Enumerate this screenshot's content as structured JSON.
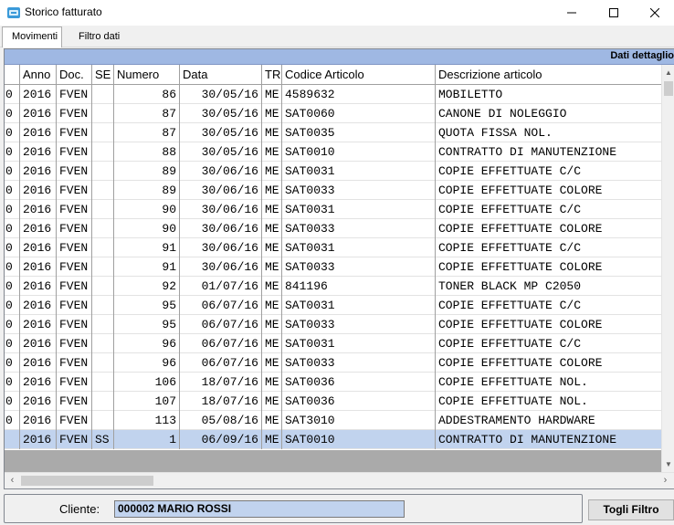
{
  "window": {
    "title": "Storico fatturato",
    "minimize_icon": "minimize-icon",
    "maximize_icon": "maximize-icon",
    "close_icon": "close-icon"
  },
  "tabs": [
    {
      "label": "Movimenti",
      "active": true
    },
    {
      "label": "Filtro dati",
      "active": false
    }
  ],
  "grid": {
    "group_header": "Dati dettaglio",
    "columns": [
      "",
      "Anno",
      "Doc.",
      "SE",
      "Numero",
      "Data",
      "TR",
      "Codice Articolo",
      "Descrizione articolo"
    ],
    "rows": [
      {
        "sel": "0",
        "anno": "2016",
        "doc": "FVEN",
        "se": "",
        "numero": "86",
        "data": "30/05/16",
        "tr": "ME",
        "codice": "4589632",
        "descrizione": "MOBILETTO"
      },
      {
        "sel": "0",
        "anno": "2016",
        "doc": "FVEN",
        "se": "",
        "numero": "87",
        "data": "30/05/16",
        "tr": "ME",
        "codice": "SAT0060",
        "descrizione": "CANONE DI NOLEGGIO"
      },
      {
        "sel": "0",
        "anno": "2016",
        "doc": "FVEN",
        "se": "",
        "numero": "87",
        "data": "30/05/16",
        "tr": "ME",
        "codice": "SAT0035",
        "descrizione": "QUOTA FISSA NOL."
      },
      {
        "sel": "0",
        "anno": "2016",
        "doc": "FVEN",
        "se": "",
        "numero": "88",
        "data": "30/05/16",
        "tr": "ME",
        "codice": "SAT0010",
        "descrizione": "CONTRATTO DI MANUTENZIONE"
      },
      {
        "sel": "0",
        "anno": "2016",
        "doc": "FVEN",
        "se": "",
        "numero": "89",
        "data": "30/06/16",
        "tr": "ME",
        "codice": "SAT0031",
        "descrizione": "COPIE EFFETTUATE C/C"
      },
      {
        "sel": "0",
        "anno": "2016",
        "doc": "FVEN",
        "se": "",
        "numero": "89",
        "data": "30/06/16",
        "tr": "ME",
        "codice": "SAT0033",
        "descrizione": "COPIE EFFETTUATE COLORE"
      },
      {
        "sel": "0",
        "anno": "2016",
        "doc": "FVEN",
        "se": "",
        "numero": "90",
        "data": "30/06/16",
        "tr": "ME",
        "codice": "SAT0031",
        "descrizione": "COPIE EFFETTUATE C/C"
      },
      {
        "sel": "0",
        "anno": "2016",
        "doc": "FVEN",
        "se": "",
        "numero": "90",
        "data": "30/06/16",
        "tr": "ME",
        "codice": "SAT0033",
        "descrizione": "COPIE EFFETTUATE COLORE"
      },
      {
        "sel": "0",
        "anno": "2016",
        "doc": "FVEN",
        "se": "",
        "numero": "91",
        "data": "30/06/16",
        "tr": "ME",
        "codice": "SAT0031",
        "descrizione": "COPIE EFFETTUATE C/C"
      },
      {
        "sel": "0",
        "anno": "2016",
        "doc": "FVEN",
        "se": "",
        "numero": "91",
        "data": "30/06/16",
        "tr": "ME",
        "codice": "SAT0033",
        "descrizione": "COPIE EFFETTUATE COLORE"
      },
      {
        "sel": "0",
        "anno": "2016",
        "doc": "FVEN",
        "se": "",
        "numero": "92",
        "data": "01/07/16",
        "tr": "ME",
        "codice": "841196",
        "descrizione": "TONER BLACK MP C2050"
      },
      {
        "sel": "0",
        "anno": "2016",
        "doc": "FVEN",
        "se": "",
        "numero": "95",
        "data": "06/07/16",
        "tr": "ME",
        "codice": "SAT0031",
        "descrizione": "COPIE EFFETTUATE C/C"
      },
      {
        "sel": "0",
        "anno": "2016",
        "doc": "FVEN",
        "se": "",
        "numero": "95",
        "data": "06/07/16",
        "tr": "ME",
        "codice": "SAT0033",
        "descrizione": "COPIE EFFETTUATE COLORE"
      },
      {
        "sel": "0",
        "anno": "2016",
        "doc": "FVEN",
        "se": "",
        "numero": "96",
        "data": "06/07/16",
        "tr": "ME",
        "codice": "SAT0031",
        "descrizione": "COPIE EFFETTUATE C/C"
      },
      {
        "sel": "0",
        "anno": "2016",
        "doc": "FVEN",
        "se": "",
        "numero": "96",
        "data": "06/07/16",
        "tr": "ME",
        "codice": "SAT0033",
        "descrizione": "COPIE EFFETTUATE COLORE"
      },
      {
        "sel": "0",
        "anno": "2016",
        "doc": "FVEN",
        "se": "",
        "numero": "106",
        "data": "18/07/16",
        "tr": "ME",
        "codice": "SAT0036",
        "descrizione": "COPIE EFFETTUATE NOL."
      },
      {
        "sel": "0",
        "anno": "2016",
        "doc": "FVEN",
        "se": "",
        "numero": "107",
        "data": "18/07/16",
        "tr": "ME",
        "codice": "SAT0036",
        "descrizione": "COPIE EFFETTUATE NOL."
      },
      {
        "sel": "0",
        "anno": "2016",
        "doc": "FVEN",
        "se": "",
        "numero": "113",
        "data": "05/08/16",
        "tr": "ME",
        "codice": "SAT3010",
        "descrizione": "ADDESTRAMENTO HARDWARE"
      },
      {
        "sel": "",
        "anno": "2016",
        "doc": "FVEN",
        "se": "SS",
        "numero": "1",
        "data": "06/09/16",
        "tr": "ME",
        "codice": "SAT0010",
        "descrizione": "CONTRATTO DI MANUTENZIONE",
        "selected": true
      }
    ]
  },
  "footer": {
    "cliente_label": "Cliente:",
    "cliente_value": "000002 MARIO ROSSI",
    "filter_button": "Togli Filtro"
  },
  "colors": {
    "group_header_bg": "#9fb8e3",
    "selected_row_bg": "#c1d3ee",
    "client_field_bg": "#c1d3ee"
  }
}
